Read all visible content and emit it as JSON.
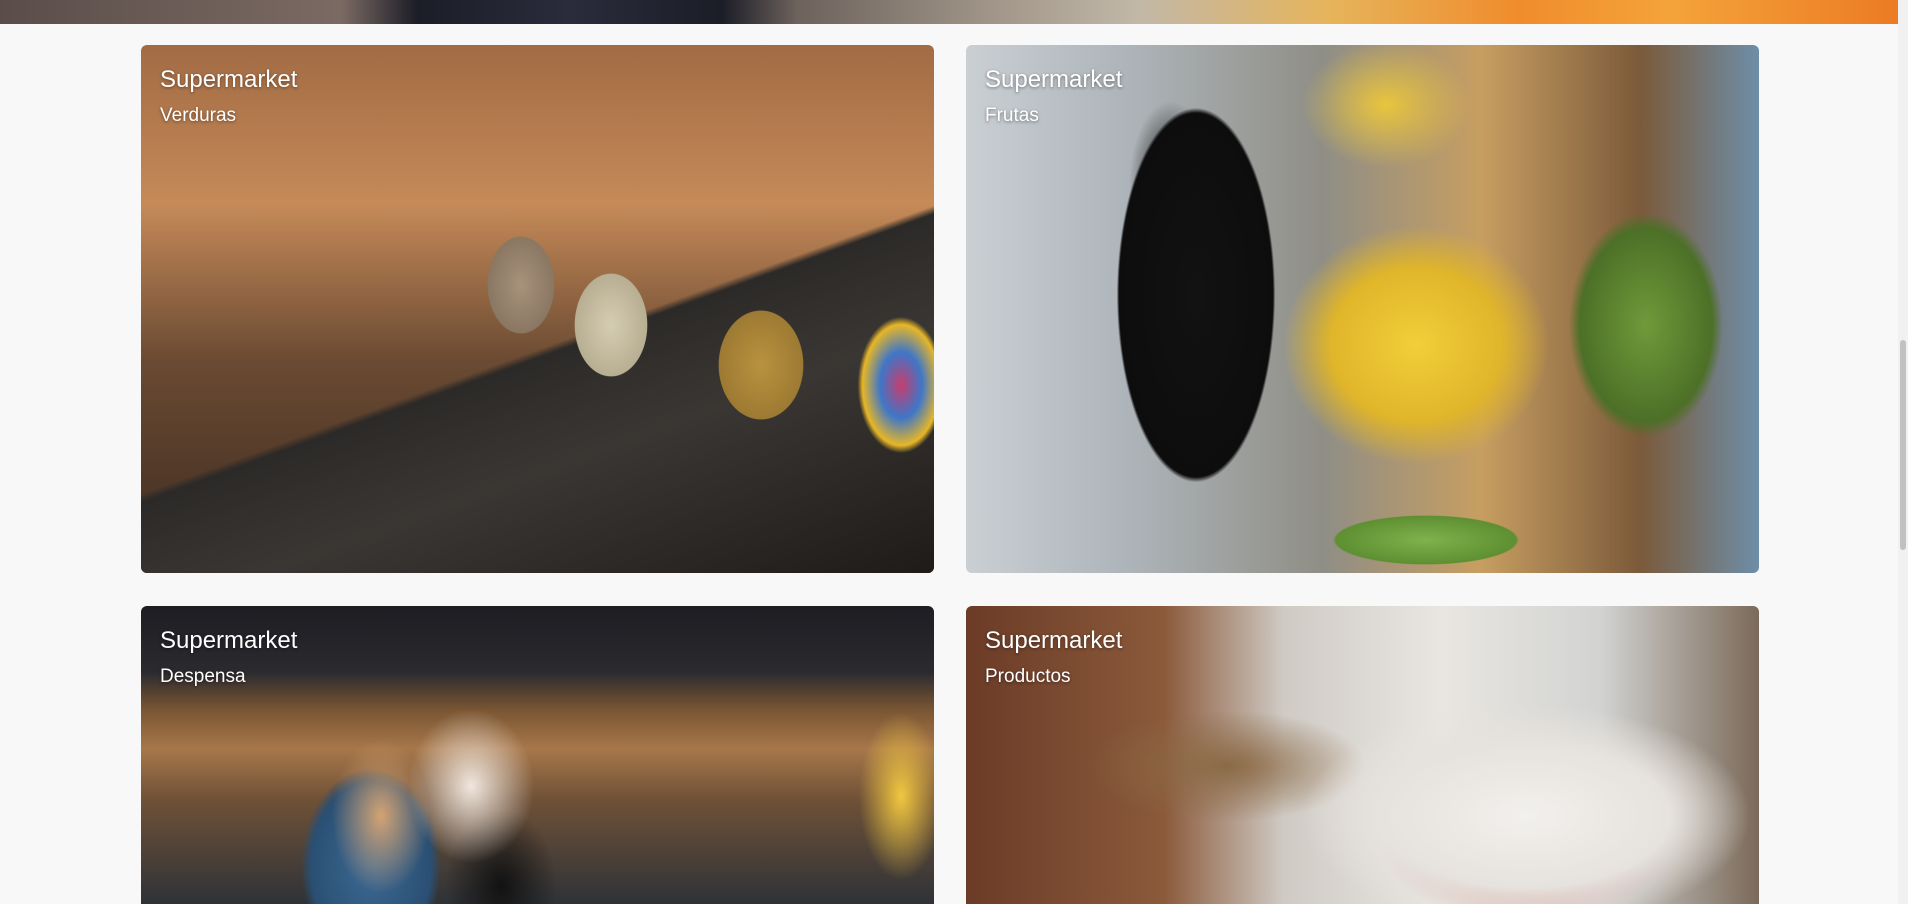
{
  "cards": [
    {
      "title": "Supermarket",
      "subtitle": "Verduras"
    },
    {
      "title": "Supermarket",
      "subtitle": "Frutas"
    },
    {
      "title": "Supermarket",
      "subtitle": "Despensa"
    },
    {
      "title": "Supermarket",
      "subtitle": "Productos"
    }
  ]
}
